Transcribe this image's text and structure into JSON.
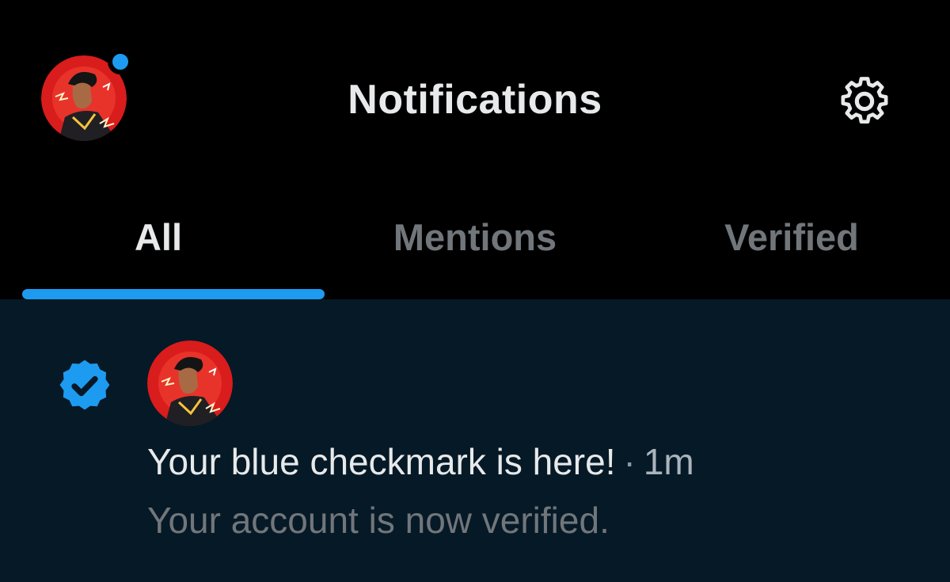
{
  "header": {
    "title": "Notifications",
    "avatar_icon": "profile-avatar",
    "settings_icon": "gear-icon",
    "has_unread": true
  },
  "tabs": [
    {
      "label": "All",
      "active": true
    },
    {
      "label": "Mentions",
      "active": false
    },
    {
      "label": "Verified",
      "active": false
    }
  ],
  "notification": {
    "badge_icon": "verified-check-icon",
    "text": "Your blue checkmark is here!",
    "separator": "·",
    "time": "1m",
    "subtext": "Your account is now verified."
  },
  "colors": {
    "accent": "#1d9bf0",
    "background": "#000000",
    "notification_background": "#061926",
    "text_primary": "#e7e9ea",
    "text_secondary": "#71767b",
    "avatar_red": "#d91c1c"
  }
}
